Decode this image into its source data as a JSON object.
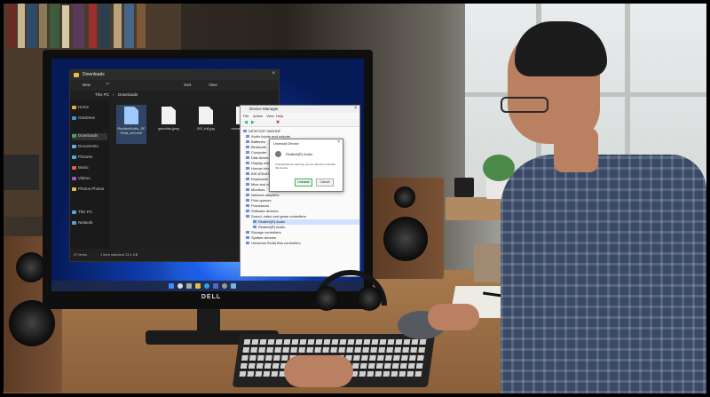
{
  "explorer": {
    "title": "Downloads",
    "toolbar": {
      "new_label": "New",
      "sort_label": "Sort",
      "view_label": "View"
    },
    "address": {
      "this_pc": "This PC",
      "folder": "Downloads"
    },
    "sidebar": [
      {
        "label": "Home",
        "icon": "home-icon"
      },
      {
        "label": "OneDrive",
        "icon": "cloud-icon"
      },
      {
        "label": "Downloads",
        "icon": "download-icon"
      },
      {
        "label": "Documents",
        "icon": "document-icon"
      },
      {
        "label": "Pictures",
        "icon": "picture-icon"
      },
      {
        "label": "Music",
        "icon": "music-icon"
      },
      {
        "label": "Videos",
        "icon": "video-icon"
      },
      {
        "label": "Photos Photos",
        "icon": "photo-icon"
      },
      {
        "label": "This PC",
        "icon": "computer-icon"
      },
      {
        "label": "Network",
        "icon": "network-icon"
      }
    ],
    "files": [
      {
        "name": "RealtekAudio_SF Rcat_x64.exe",
        "selected": true
      },
      {
        "name": "gwrsdds.jpeg",
        "selected": false
      },
      {
        "name": "BO_full.jpg",
        "selected": false
      },
      {
        "name": "romantikleniem ..exe",
        "selected": false
      }
    ],
    "status": {
      "items": "37 items",
      "selection": "1 item selected 13.1 KB"
    }
  },
  "device_manager": {
    "title": "Device Manager",
    "menu": [
      "File",
      "Action",
      "View",
      "Help"
    ],
    "tree": [
      "DESKTOP-3M2HNF",
      "Audio inputs and outputs",
      "Batteries",
      "Bluetooth",
      "Computer",
      "Disk drives",
      "Display adapters",
      "Human Interface Devices",
      "IDE ATA/ATAPI controllers",
      "Keyboards",
      "Mice and other pointing devices",
      "Monitors",
      "Network adapters",
      "Print queues",
      "Processors",
      "Software devices",
      "Sound, video and game controllers",
      "Realtek(R) Audio",
      "Realtek(R) Audio",
      "Storage controllers",
      "System devices",
      "Universal Serial Bus controllers"
    ]
  },
  "dialog": {
    "title": "Uninstall Device",
    "device": "Realtek(R) Audio",
    "warning": "Uninstall device warning: you are about to uninstall this device.",
    "uninstall_label": "Uninstall",
    "cancel_label": "Cancel"
  },
  "monitor": {
    "brand": "DELL"
  },
  "colors": {
    "highlight_button_border": "#22c24a",
    "wallpaper_blue": "#0d3aa8",
    "explorer_dark": "#1e1e1e"
  }
}
